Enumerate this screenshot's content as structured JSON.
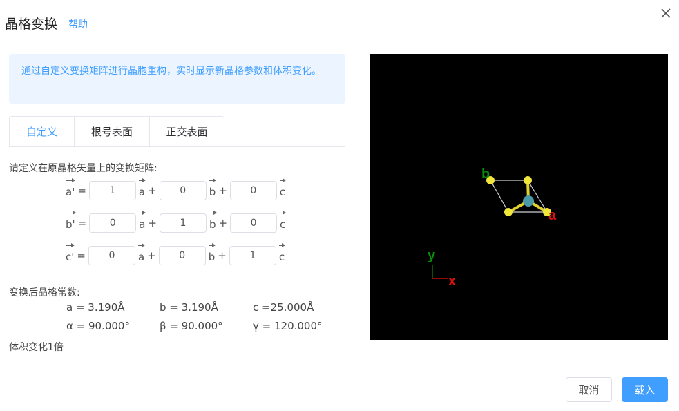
{
  "dialog": {
    "title": "晶格变换",
    "help_label": "帮助"
  },
  "tip": "通过自定义变换矩阵进行晶胞重构，实时显示新晶格参数和体积变化。",
  "tabs": [
    {
      "label": "自定义",
      "active": true
    },
    {
      "label": "根号表面",
      "active": false
    },
    {
      "label": "正交表面",
      "active": false
    }
  ],
  "matrix": {
    "label": "请定义在原晶格矢量上的变换矩阵:",
    "basis": [
      "a",
      "b",
      "c"
    ],
    "rows": [
      {
        "prime": "a'",
        "values": [
          "1",
          "0",
          "0"
        ]
      },
      {
        "prime": "b'",
        "values": [
          "0",
          "1",
          "0"
        ]
      },
      {
        "prime": "c'",
        "values": [
          "0",
          "0",
          "1"
        ]
      }
    ]
  },
  "lattice": {
    "label": "变换后晶格常数:",
    "a": "a = 3.190Å",
    "b": "b = 3.190Å",
    "c": "c =25.000Å",
    "alpha": "α = 90.000°",
    "beta": "β = 90.000°",
    "gamma": "γ = 120.000°"
  },
  "volume_change": "体积变化1倍",
  "viewer": {
    "axis_labels": {
      "a": "a",
      "b": "b",
      "x": "x",
      "y": "y"
    },
    "colors": {
      "background": "#000000",
      "atom_s": "#f0e63c",
      "atom_metal": "#4a9aa8",
      "label_a": "#e01010",
      "label_b": "#0a8a0a"
    }
  },
  "buttons": {
    "cancel": "取消",
    "load": "载入"
  },
  "colors": {
    "accent": "#409eff",
    "tip_bg": "#ecf5ff"
  }
}
